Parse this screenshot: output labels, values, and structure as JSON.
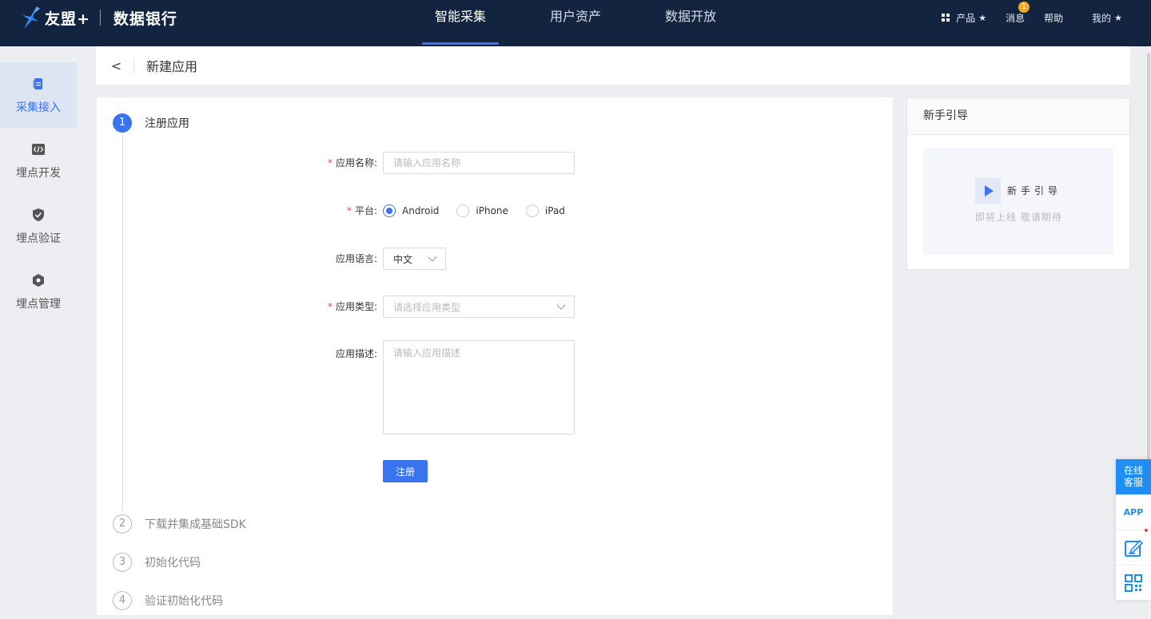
{
  "topbar": {
    "brand": "友盟+",
    "product": "数据银行",
    "nav": [
      {
        "label": "智能采集"
      },
      {
        "label": "用户资产"
      },
      {
        "label": "数据开放"
      }
    ],
    "right": {
      "products": "产品",
      "messages": "消息",
      "message_count": "1",
      "help": "帮助",
      "mine": "我的"
    }
  },
  "sidebar": {
    "items": [
      {
        "label": "采集接入"
      },
      {
        "label": "埋点开发"
      },
      {
        "label": "埋点验证"
      },
      {
        "label": "埋点管理"
      }
    ]
  },
  "header": {
    "back": "<",
    "title": "新建应用"
  },
  "steps": [
    {
      "num": "1",
      "title": "注册应用"
    },
    {
      "num": "2",
      "title": "下载并集成基础SDK"
    },
    {
      "num": "3",
      "title": "初始化代码"
    },
    {
      "num": "4",
      "title": "验证初始化代码"
    }
  ],
  "form": {
    "app_name": {
      "label": "应用名称:",
      "placeholder": "请输入应用名称"
    },
    "platform": {
      "label": "平台:",
      "options": [
        "Android",
        "iPhone",
        "iPad"
      ],
      "selected": "Android"
    },
    "language": {
      "label": "应用语言:",
      "value": "中文"
    },
    "app_type": {
      "label": "应用类型:",
      "placeholder": "请选择应用类型"
    },
    "description": {
      "label": "应用描述:",
      "placeholder": "请输入应用描述"
    },
    "submit": "注册"
  },
  "guide": {
    "header": "新手引导",
    "title": "新手引导",
    "subtitle": "即将上线 敬请期待"
  },
  "float_tools": {
    "chat": "在线客服",
    "app": "APP"
  }
}
